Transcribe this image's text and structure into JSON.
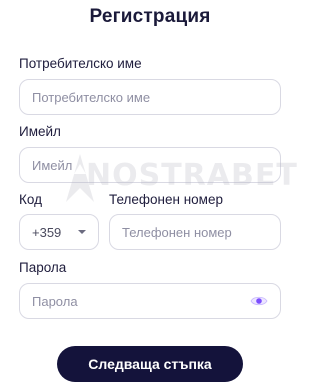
{
  "form": {
    "title": "Регистрация",
    "username": {
      "label": "Потребителско име",
      "placeholder": "Потребителско име",
      "value": ""
    },
    "email": {
      "label": "Имейл",
      "placeholder": "Имейл",
      "value": ""
    },
    "code": {
      "label": "Код",
      "value": "+359"
    },
    "phone": {
      "label": "Телефонен номер",
      "placeholder": "Телефонен номер",
      "value": ""
    },
    "password": {
      "label": "Парола",
      "placeholder": "Парола",
      "value": ""
    },
    "next_label": "Следваща стъпка"
  },
  "watermark": {
    "text": "NOSTRABET"
  },
  "colors": {
    "primary": "#14133b",
    "eye_accent": "#7c4dff",
    "border": "#d9d9e3"
  },
  "icons": {
    "dropdown": "chevron-down-icon",
    "password_toggle": "eye-icon"
  }
}
